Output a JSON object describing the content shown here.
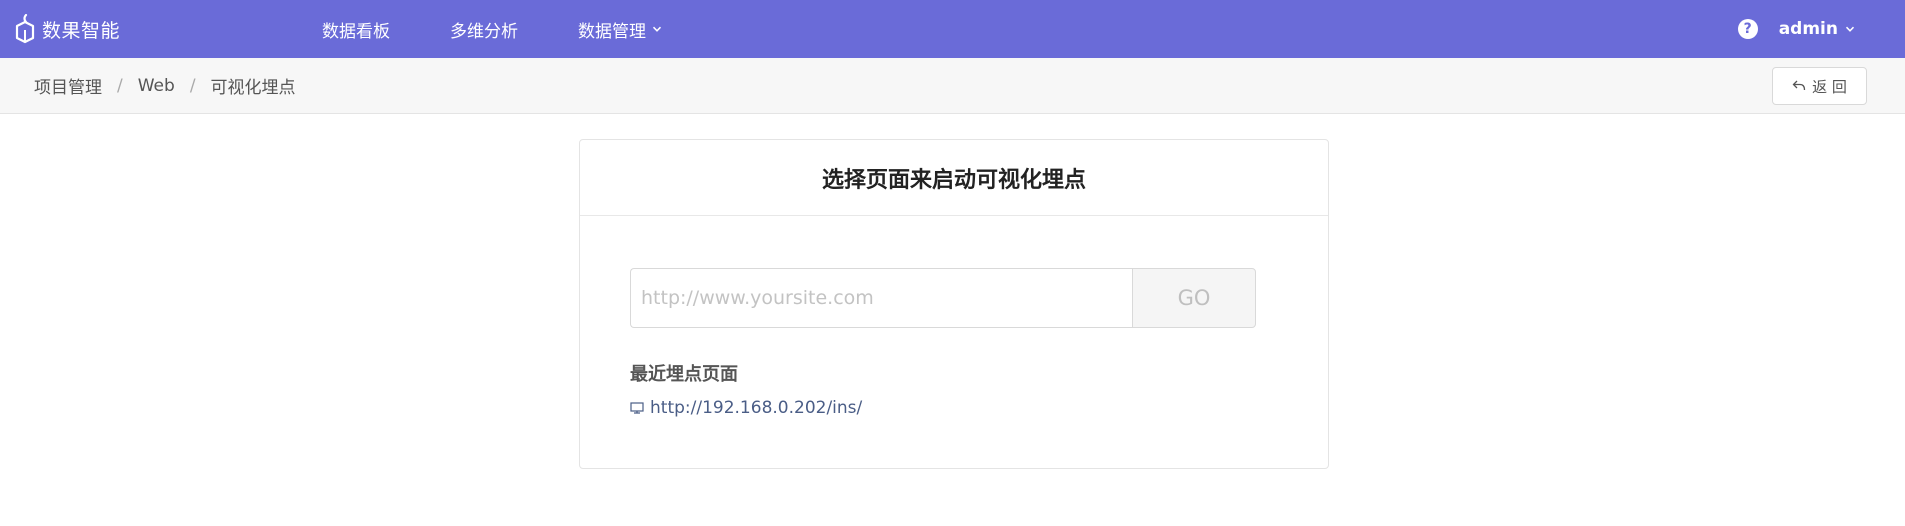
{
  "brand": {
    "name": "数果智能"
  },
  "nav": {
    "items": [
      {
        "label": "数据看板",
        "has_dropdown": false
      },
      {
        "label": "多维分析",
        "has_dropdown": false
      },
      {
        "label": "数据管理",
        "has_dropdown": true
      }
    ]
  },
  "header_right": {
    "help_symbol": "?",
    "user": "admin"
  },
  "breadcrumb": {
    "items": [
      "项目管理",
      "Web",
      "可视化埋点"
    ],
    "separator": "/"
  },
  "back_button": {
    "label": "返 回"
  },
  "card": {
    "title": "选择页面来启动可视化埋点",
    "url_input": {
      "value": "",
      "placeholder": "http://www.yoursite.com"
    },
    "go_label": "GO",
    "recent": {
      "title": "最近埋点页面",
      "links": [
        "http://192.168.0.202/ins/"
      ]
    }
  },
  "colors": {
    "header_bg": "#6a6bd8",
    "link": "#4a5d86"
  }
}
